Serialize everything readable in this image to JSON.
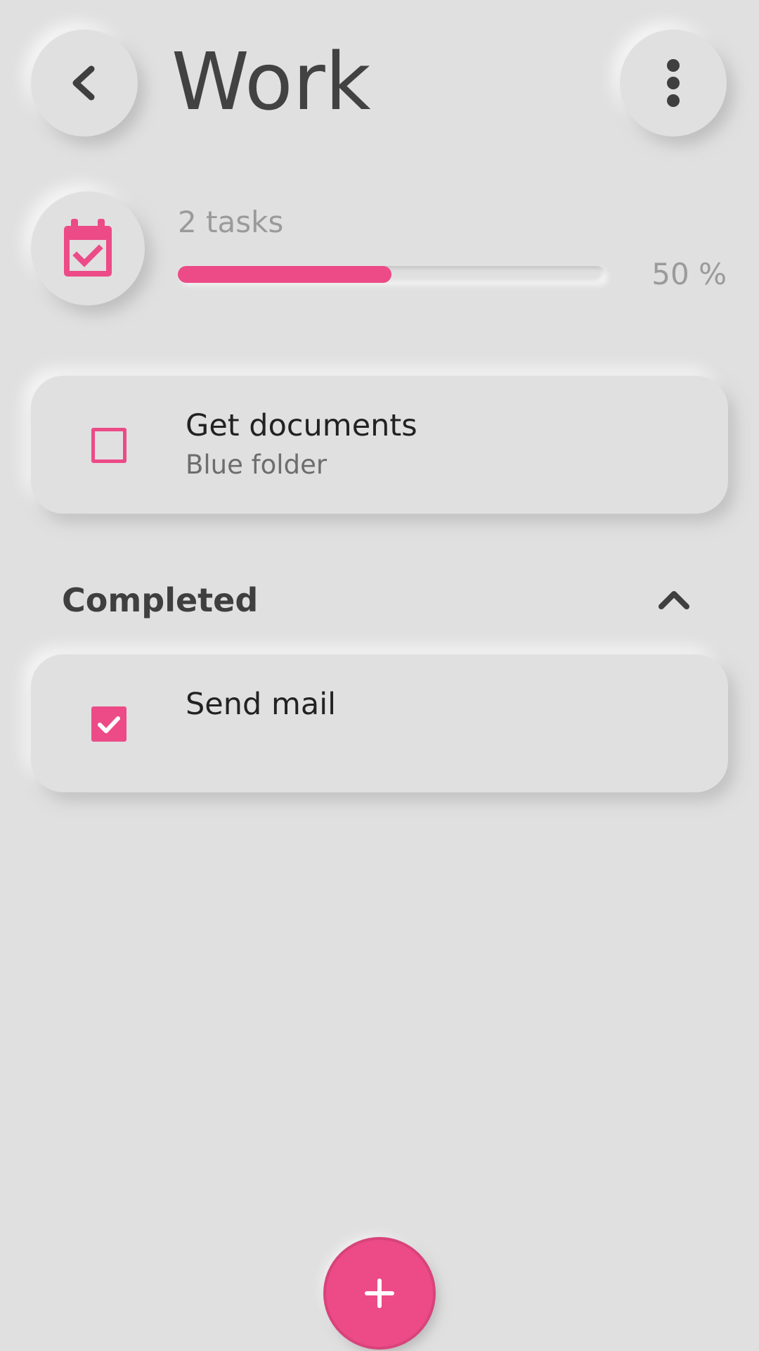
{
  "header": {
    "title": "Work",
    "back_icon": "chevron-left-icon",
    "more_icon": "more-vert-icon"
  },
  "summary": {
    "icon": "calendar-check-icon",
    "task_count": "2 tasks",
    "progress_percent": 50,
    "progress_label": "50 %"
  },
  "tasks": [
    {
      "title": "Get documents",
      "subtitle": "Blue folder",
      "completed": false
    }
  ],
  "completed_section": {
    "title": "Completed",
    "toggle_icon": "chevron-up-icon",
    "items": [
      {
        "title": "Send mail",
        "completed": true
      }
    ]
  },
  "fab": {
    "icon": "plus-icon"
  },
  "colors": {
    "accent": "#ec4b87",
    "background": "#e0e0e0",
    "title_text": "#424242",
    "muted_text": "#9a9a9a"
  }
}
